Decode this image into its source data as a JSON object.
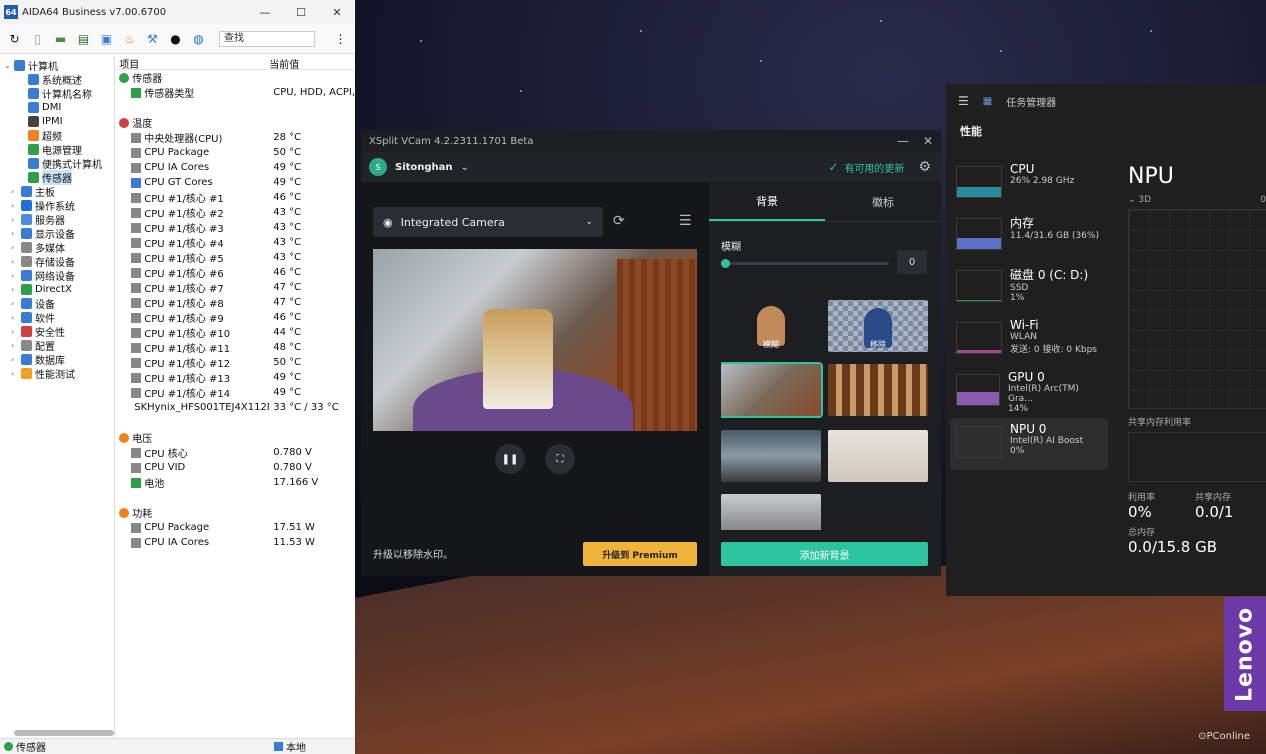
{
  "aida": {
    "logo": "64",
    "title": "AIDA64 Business v7.00.6700",
    "search": "查找",
    "tree": [
      {
        "label": "计算机",
        "ex": "⌄",
        "color": "#3a7bd5",
        "indent": 0
      },
      {
        "label": "系统概述",
        "ex": "",
        "color": "#3a7bd5",
        "indent": 2
      },
      {
        "label": "计算机名称",
        "ex": "",
        "color": "#3a7bd5",
        "indent": 2
      },
      {
        "label": "DMI",
        "ex": "",
        "color": "#3a7bd5",
        "indent": 2
      },
      {
        "label": "IPMI",
        "ex": "",
        "color": "#444",
        "indent": 2
      },
      {
        "label": "超频",
        "ex": "",
        "color": "#f08020",
        "indent": 2
      },
      {
        "label": "电源管理",
        "ex": "",
        "color": "#2ea04a",
        "indent": 2
      },
      {
        "label": "便携式计算机",
        "ex": "",
        "color": "#3a7bd5",
        "indent": 2
      },
      {
        "label": "传感器",
        "ex": "",
        "color": "#2ea04a",
        "indent": 2,
        "sel": true
      },
      {
        "label": "主板",
        "ex": "›",
        "color": "#3a7bd5",
        "indent": 1
      },
      {
        "label": "操作系统",
        "ex": "›",
        "color": "#1e6fd9",
        "indent": 1
      },
      {
        "label": "服务器",
        "ex": "›",
        "color": "#4a8ae0",
        "indent": 1
      },
      {
        "label": "显示设备",
        "ex": "›",
        "color": "#3a7bd5",
        "indent": 1
      },
      {
        "label": "多媒体",
        "ex": "›",
        "color": "#888",
        "indent": 1
      },
      {
        "label": "存储设备",
        "ex": "›",
        "color": "#888",
        "indent": 1
      },
      {
        "label": "网络设备",
        "ex": "›",
        "color": "#3a7bd5",
        "indent": 1
      },
      {
        "label": "DirectX",
        "ex": "›",
        "color": "#2ea04a",
        "indent": 1
      },
      {
        "label": "设备",
        "ex": "›",
        "color": "#3a7bd5",
        "indent": 1
      },
      {
        "label": "软件",
        "ex": "›",
        "color": "#3a7bd5",
        "indent": 1
      },
      {
        "label": "安全性",
        "ex": "›",
        "color": "#d04040",
        "indent": 1
      },
      {
        "label": "配置",
        "ex": "›",
        "color": "#888",
        "indent": 1
      },
      {
        "label": "数据库",
        "ex": "›",
        "color": "#3a7bd5",
        "indent": 1
      },
      {
        "label": "性能测试",
        "ex": "›",
        "color": "#f0a020",
        "indent": 1
      }
    ],
    "col_item": "项目",
    "col_value": "当前值",
    "sections": [
      {
        "title": "传感器",
        "color": "#2ea04a",
        "rows": [
          {
            "k": "传感器类型",
            "v": "CPU, HDD, ACPI,",
            "color": "#2ea04a"
          }
        ]
      },
      {
        "title": "温度",
        "color": "#d04040",
        "rows": [
          {
            "k": "中央处理器(CPU)",
            "v": "28 °C",
            "color": "#888"
          },
          {
            "k": "CPU Package",
            "v": "50 °C",
            "color": "#888"
          },
          {
            "k": "CPU IA Cores",
            "v": "49 °C",
            "color": "#888"
          },
          {
            "k": "CPU GT Cores",
            "v": "49 °C",
            "color": "#3a7bd5"
          },
          {
            "k": "CPU #1/核心 #1",
            "v": "46 °C",
            "color": "#888"
          },
          {
            "k": "CPU #1/核心 #2",
            "v": "43 °C",
            "color": "#888"
          },
          {
            "k": "CPU #1/核心 #3",
            "v": "43 °C",
            "color": "#888"
          },
          {
            "k": "CPU #1/核心 #4",
            "v": "43 °C",
            "color": "#888"
          },
          {
            "k": "CPU #1/核心 #5",
            "v": "43 °C",
            "color": "#888"
          },
          {
            "k": "CPU #1/核心 #6",
            "v": "46 °C",
            "color": "#888"
          },
          {
            "k": "CPU #1/核心 #7",
            "v": "47 °C",
            "color": "#888"
          },
          {
            "k": "CPU #1/核心 #8",
            "v": "47 °C",
            "color": "#888"
          },
          {
            "k": "CPU #1/核心 #9",
            "v": "46 °C",
            "color": "#888"
          },
          {
            "k": "CPU #1/核心 #10",
            "v": "44 °C",
            "color": "#888"
          },
          {
            "k": "CPU #1/核心 #11",
            "v": "48 °C",
            "color": "#888"
          },
          {
            "k": "CPU #1/核心 #12",
            "v": "50 °C",
            "color": "#888"
          },
          {
            "k": "CPU #1/核心 #13",
            "v": "49 °C",
            "color": "#888"
          },
          {
            "k": "CPU #1/核心 #14",
            "v": "49 °C",
            "color": "#888"
          },
          {
            "k": "SKHynix_HFS001TEJ4X112N",
            "v": "33 °C / 33 °C",
            "color": "#666"
          }
        ]
      },
      {
        "title": "电压",
        "color": "#f08020",
        "rows": [
          {
            "k": "CPU 核心",
            "v": "0.780 V",
            "color": "#888"
          },
          {
            "k": "CPU VID",
            "v": "0.780 V",
            "color": "#888"
          },
          {
            "k": "电池",
            "v": "17.166 V",
            "color": "#2ea04a"
          }
        ]
      },
      {
        "title": "功耗",
        "color": "#f08020",
        "rows": [
          {
            "k": "CPU Package",
            "v": "17.51 W",
            "color": "#888"
          },
          {
            "k": "CPU IA Cores",
            "v": "11.53 W",
            "color": "#888"
          }
        ]
      }
    ],
    "status_left": "传感器",
    "status_right": "本地"
  },
  "xsplit": {
    "title": "XSplit VCam 4.2.2311.1701 Beta",
    "avatar": "S",
    "user": "Sitonghan",
    "update": "有可用的更新",
    "camera": "Integrated Camera",
    "upgrade_text": "升级以移除水印。",
    "premium_btn": "升级到 Premium",
    "tab_bg": "背景",
    "tab_logo": "徽标",
    "blur_label": "模糊",
    "blur_value": "0",
    "blur_level": 0,
    "thumb_blur": "模糊",
    "thumb_remove": "移除",
    "add_bg": "添加新背景"
  },
  "tm": {
    "title": "任务管理器",
    "perf": "性能",
    "items": [
      {
        "name": "CPU",
        "s1": "26%  2.98 GHz",
        "s2": "",
        "color": "#2a8aa0",
        "level": 0.35
      },
      {
        "name": "内存",
        "s1": "11.4/31.6 GB (36%)",
        "s2": "",
        "color": "#5a70c8",
        "level": 0.36
      },
      {
        "name": "磁盘 0 (C: D:)",
        "s1": "SSD",
        "s2": "1%",
        "color": "#3a8a4a",
        "level": 0.05
      },
      {
        "name": "Wi-Fi",
        "s1": "WLAN",
        "s2": "发送: 0 接收: 0 Kbps",
        "color": "#a04a8a",
        "level": 0.1
      },
      {
        "name": "GPU 0",
        "s1": "Intel(R) Arc(TM) Gra...",
        "s2": "14%",
        "color": "#8a5ab0",
        "level": 0.45
      },
      {
        "name": "NPU 0",
        "s1": "Intel(R) AI Boost",
        "s2": "0%",
        "color": "#2a8aa0",
        "level": 0.0
      }
    ],
    "main_title": "NPU",
    "d3": "⌄ 3D",
    "d3_val": "0",
    "shared_mem": "共享内存利用率",
    "util_lbl": "利用率",
    "util_val": "0%",
    "shared_lbl": "共享内存",
    "shared_val": "0.0/1",
    "total_lbl": "总内存",
    "total_val": "0.0/15.8 GB"
  },
  "lenovo": "Lenovo",
  "watermark": "⊙PConline"
}
